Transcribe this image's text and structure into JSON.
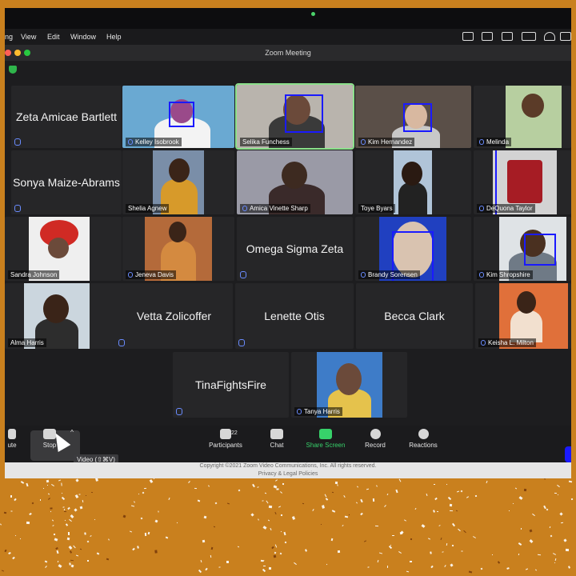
{
  "menubar": {
    "items": [
      "ng",
      "View",
      "Edit",
      "Window",
      "Help"
    ]
  },
  "window": {
    "title": "Zoom Meeting"
  },
  "gallery": {
    "tiles": [
      {
        "name": "Zeta Amicae Bartlett",
        "video": false
      },
      {
        "name": "Kelley Isobrook",
        "video": true
      },
      {
        "name": "Selika Funchess",
        "video": true,
        "active": true
      },
      {
        "name": "Kim Hernandez",
        "video": true
      },
      {
        "name": "Melinda",
        "video": true
      },
      {
        "name": "Sonya Maize-Abrams",
        "video": false
      },
      {
        "name": "Shelia Agnew",
        "video": true
      },
      {
        "name": "Amica Vinette Sharp",
        "video": true
      },
      {
        "name": "Toye Byars",
        "video": true
      },
      {
        "name": "DeQuona Taylor",
        "video": true
      },
      {
        "name": "Sandra Johnson",
        "video": true
      },
      {
        "name": "Jeneva Davis",
        "video": true
      },
      {
        "name": "Omega Sigma Zeta",
        "video": false
      },
      {
        "name": "Brandy Sorensen",
        "video": true
      },
      {
        "name": "Kim Shropshire",
        "video": true
      },
      {
        "name": "Alma Harris",
        "video": true
      },
      {
        "name": "Vetta Zolicoffer",
        "video": false
      },
      {
        "name": "Lenette Otis",
        "video": false
      },
      {
        "name": "Becca Clark",
        "video": false
      },
      {
        "name": "Keisha L. Milton",
        "video": true
      },
      {
        "name": "TinaFightsFire",
        "video": false
      },
      {
        "name": "Tanya Harris",
        "video": true
      }
    ]
  },
  "toolbar": {
    "mute_label": "ute",
    "stop_video_label": "Stop",
    "video_tooltip": "Video (⇧⌘V)",
    "participants_label": "Participants",
    "participants_count": "22",
    "chat_label": "Chat",
    "share_label": "Share Screen",
    "record_label": "Record",
    "reactions_label": "Reactions"
  },
  "footer": {
    "line1": "Copyright ©2021 Zoom Video Communications, Inc. All rights reserved.",
    "line2": "Privacy & Legal Policies"
  },
  "colors": {
    "accent_green": "#37d16a",
    "detection_box": "#1a1aff",
    "frame_orange": "#c9801e",
    "active_speaker": "#8be08b"
  },
  "icons": [
    "shield-icon",
    "mic-muted-icon",
    "video-camera-icon",
    "participants-icon",
    "chat-icon",
    "share-screen-icon",
    "record-icon",
    "reactions-icon",
    "mouse-cursor-icon"
  ]
}
